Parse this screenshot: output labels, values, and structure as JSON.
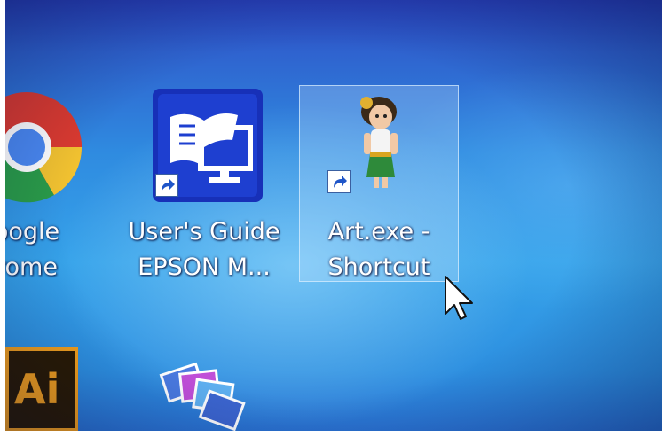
{
  "desktop": {
    "icons": [
      {
        "name": "google-chrome",
        "label_lines": [
          "oogle",
          "rome"
        ],
        "shortcut": false
      },
      {
        "name": "epson-users-guide",
        "label_lines": [
          "User's Guide",
          "EPSON M..."
        ],
        "shortcut": true
      },
      {
        "name": "art-exe",
        "label_lines": [
          "Art.exe -",
          "Shortcut"
        ],
        "shortcut": true,
        "selected": true
      },
      {
        "name": "adobe-illustrator",
        "label_lines": [],
        "icon_text": "Ai"
      },
      {
        "name": "photo-gallery",
        "label_lines": []
      }
    ]
  },
  "colors": {
    "wallpaper_top": "#2840b8",
    "wallpaper_mid": "#36a3ea",
    "selection": "#c8e6ff",
    "chrome_red": "#db3a2f",
    "chrome_yellow": "#f2c230",
    "chrome_green": "#2a9b48",
    "chrome_blue": "#4a88f0",
    "epson_blue": "#1730b8",
    "illustrator_bg": "#2a1a00",
    "illustrator_text": "#f7a21b"
  }
}
